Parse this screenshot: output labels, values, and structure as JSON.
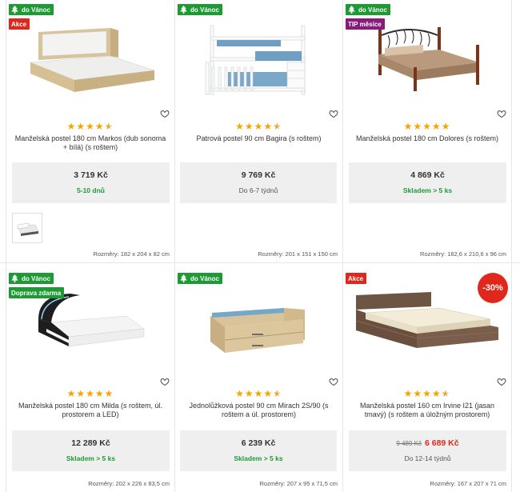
{
  "products": [
    {
      "badges": [
        {
          "label": "do Vánoc",
          "type": "green",
          "tree": true
        },
        {
          "label": "Akce",
          "type": "red",
          "tree": false
        }
      ],
      "rating": 4.5,
      "name": "Manželská postel 180 cm Markos (dub sonoma + bílá) (s roštem)",
      "price": "3 719 Kč",
      "availability": "5-10 dnů",
      "availability_style": "green",
      "dims": "Rozměry: 182 x 204 x 82 cm"
    },
    {
      "badges": [
        {
          "label": "do Vánoc",
          "type": "green",
          "tree": true
        }
      ],
      "rating": 4.5,
      "name": "Patrová postel 90 cm Bagira (s roštem)",
      "price": "9 769 Kč",
      "availability": "Do 6-7 týdnů",
      "availability_style": "gray",
      "dims": "Rozměry: 201 x 151 x 150 cm"
    },
    {
      "badges": [
        {
          "label": "do Vánoc",
          "type": "green",
          "tree": true
        },
        {
          "label": "TIP měsíce",
          "type": "purple",
          "tree": false
        }
      ],
      "rating": 5,
      "name": "Manželská postel 180 cm Dolores (s roštem)",
      "price": "4 869 Kč",
      "availability": "Skladem > 5 ks",
      "availability_style": "green",
      "dims": "Rozměry: 182,6 x 210,6 x 96 cm"
    },
    {
      "badges": [
        {
          "label": "do Vánoc",
          "type": "green",
          "tree": true
        },
        {
          "label": "Doprava zdarma",
          "type": "green",
          "tree": false
        }
      ],
      "rating": 5,
      "name": "Manželská postel 180 cm Milda (s roštem, úl. prostorem a LED)",
      "price": "12 289 Kč",
      "availability": "Skladem > 5 ks",
      "availability_style": "green",
      "dims": "Rozměry: 202 x 226 x 83,5 cm"
    },
    {
      "badges": [
        {
          "label": "do Vánoc",
          "type": "green",
          "tree": true
        }
      ],
      "rating": 4.5,
      "name": "Jednolůžková postel 90 cm Mirach 2S/90 (s roštem a úl. prostorem)",
      "price": "6 239 Kč",
      "availability": "Skladem > 5 ks",
      "availability_style": "green",
      "dims": "Rozměry: 207 x 95 x 71,5 cm"
    },
    {
      "badges": [
        {
          "label": "Akce",
          "type": "red",
          "tree": false
        }
      ],
      "discount": "-30%",
      "rating": 4.5,
      "name": "Manželská postel 160 cm Irvine I21 (jasan tmavý) (s roštem a úložným prostorem)",
      "old_price": "9 489 Kč",
      "price": "6 689 Kč",
      "availability": "Do 12-14 týdnů",
      "availability_style": "gray",
      "dims": "Rozměry: 167 x 207 x 71 cm"
    }
  ],
  "colors": {
    "green": "#1e9a34",
    "red": "#e1261c",
    "purple": "#8a1a7c",
    "star": "#f5a400"
  }
}
